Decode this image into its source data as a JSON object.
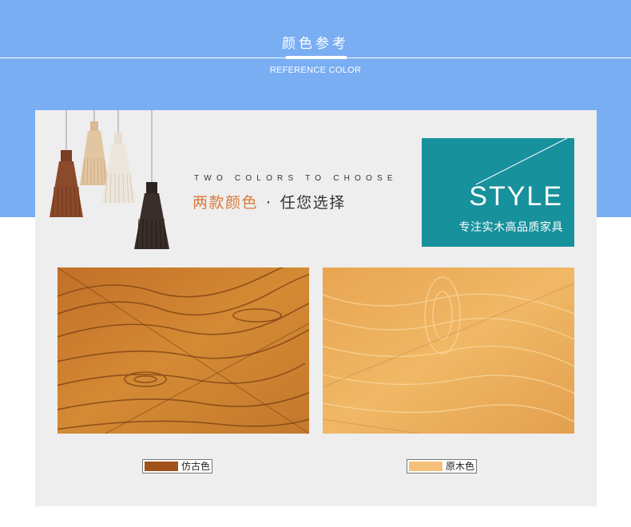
{
  "header": {
    "title": "颜色参考",
    "subtitle": "REFERENCE COLOR"
  },
  "tagline": {
    "english": "TWO COLORS TO CHOOSE",
    "chinese_accent": "两款颜色",
    "separator": "·",
    "chinese_rest": "任您选择"
  },
  "style_box": {
    "word": "STYLE",
    "subtitle": "专注实木高品质家具",
    "color": "#17919c"
  },
  "colors": {
    "background_top": "#7aaef3",
    "panel": "#eeeeee",
    "accent_text": "#d97a3a"
  },
  "swatches": [
    {
      "label": "仿古色",
      "chip_color": "#a0521a",
      "wood_base": "#c9782a",
      "grain": "#7a3e12"
    },
    {
      "label": "原木色",
      "chip_color": "#f5c07a",
      "wood_base": "#e8aa5a",
      "grain": "#f6d08e"
    }
  ],
  "lamps": [
    {
      "name": "dark-walnut",
      "color": "#8b4a2a"
    },
    {
      "name": "light-birch",
      "color": "#e2c6a2"
    },
    {
      "name": "white",
      "color": "#ede6dc"
    },
    {
      "name": "black",
      "color": "#3a2e2a"
    }
  ]
}
